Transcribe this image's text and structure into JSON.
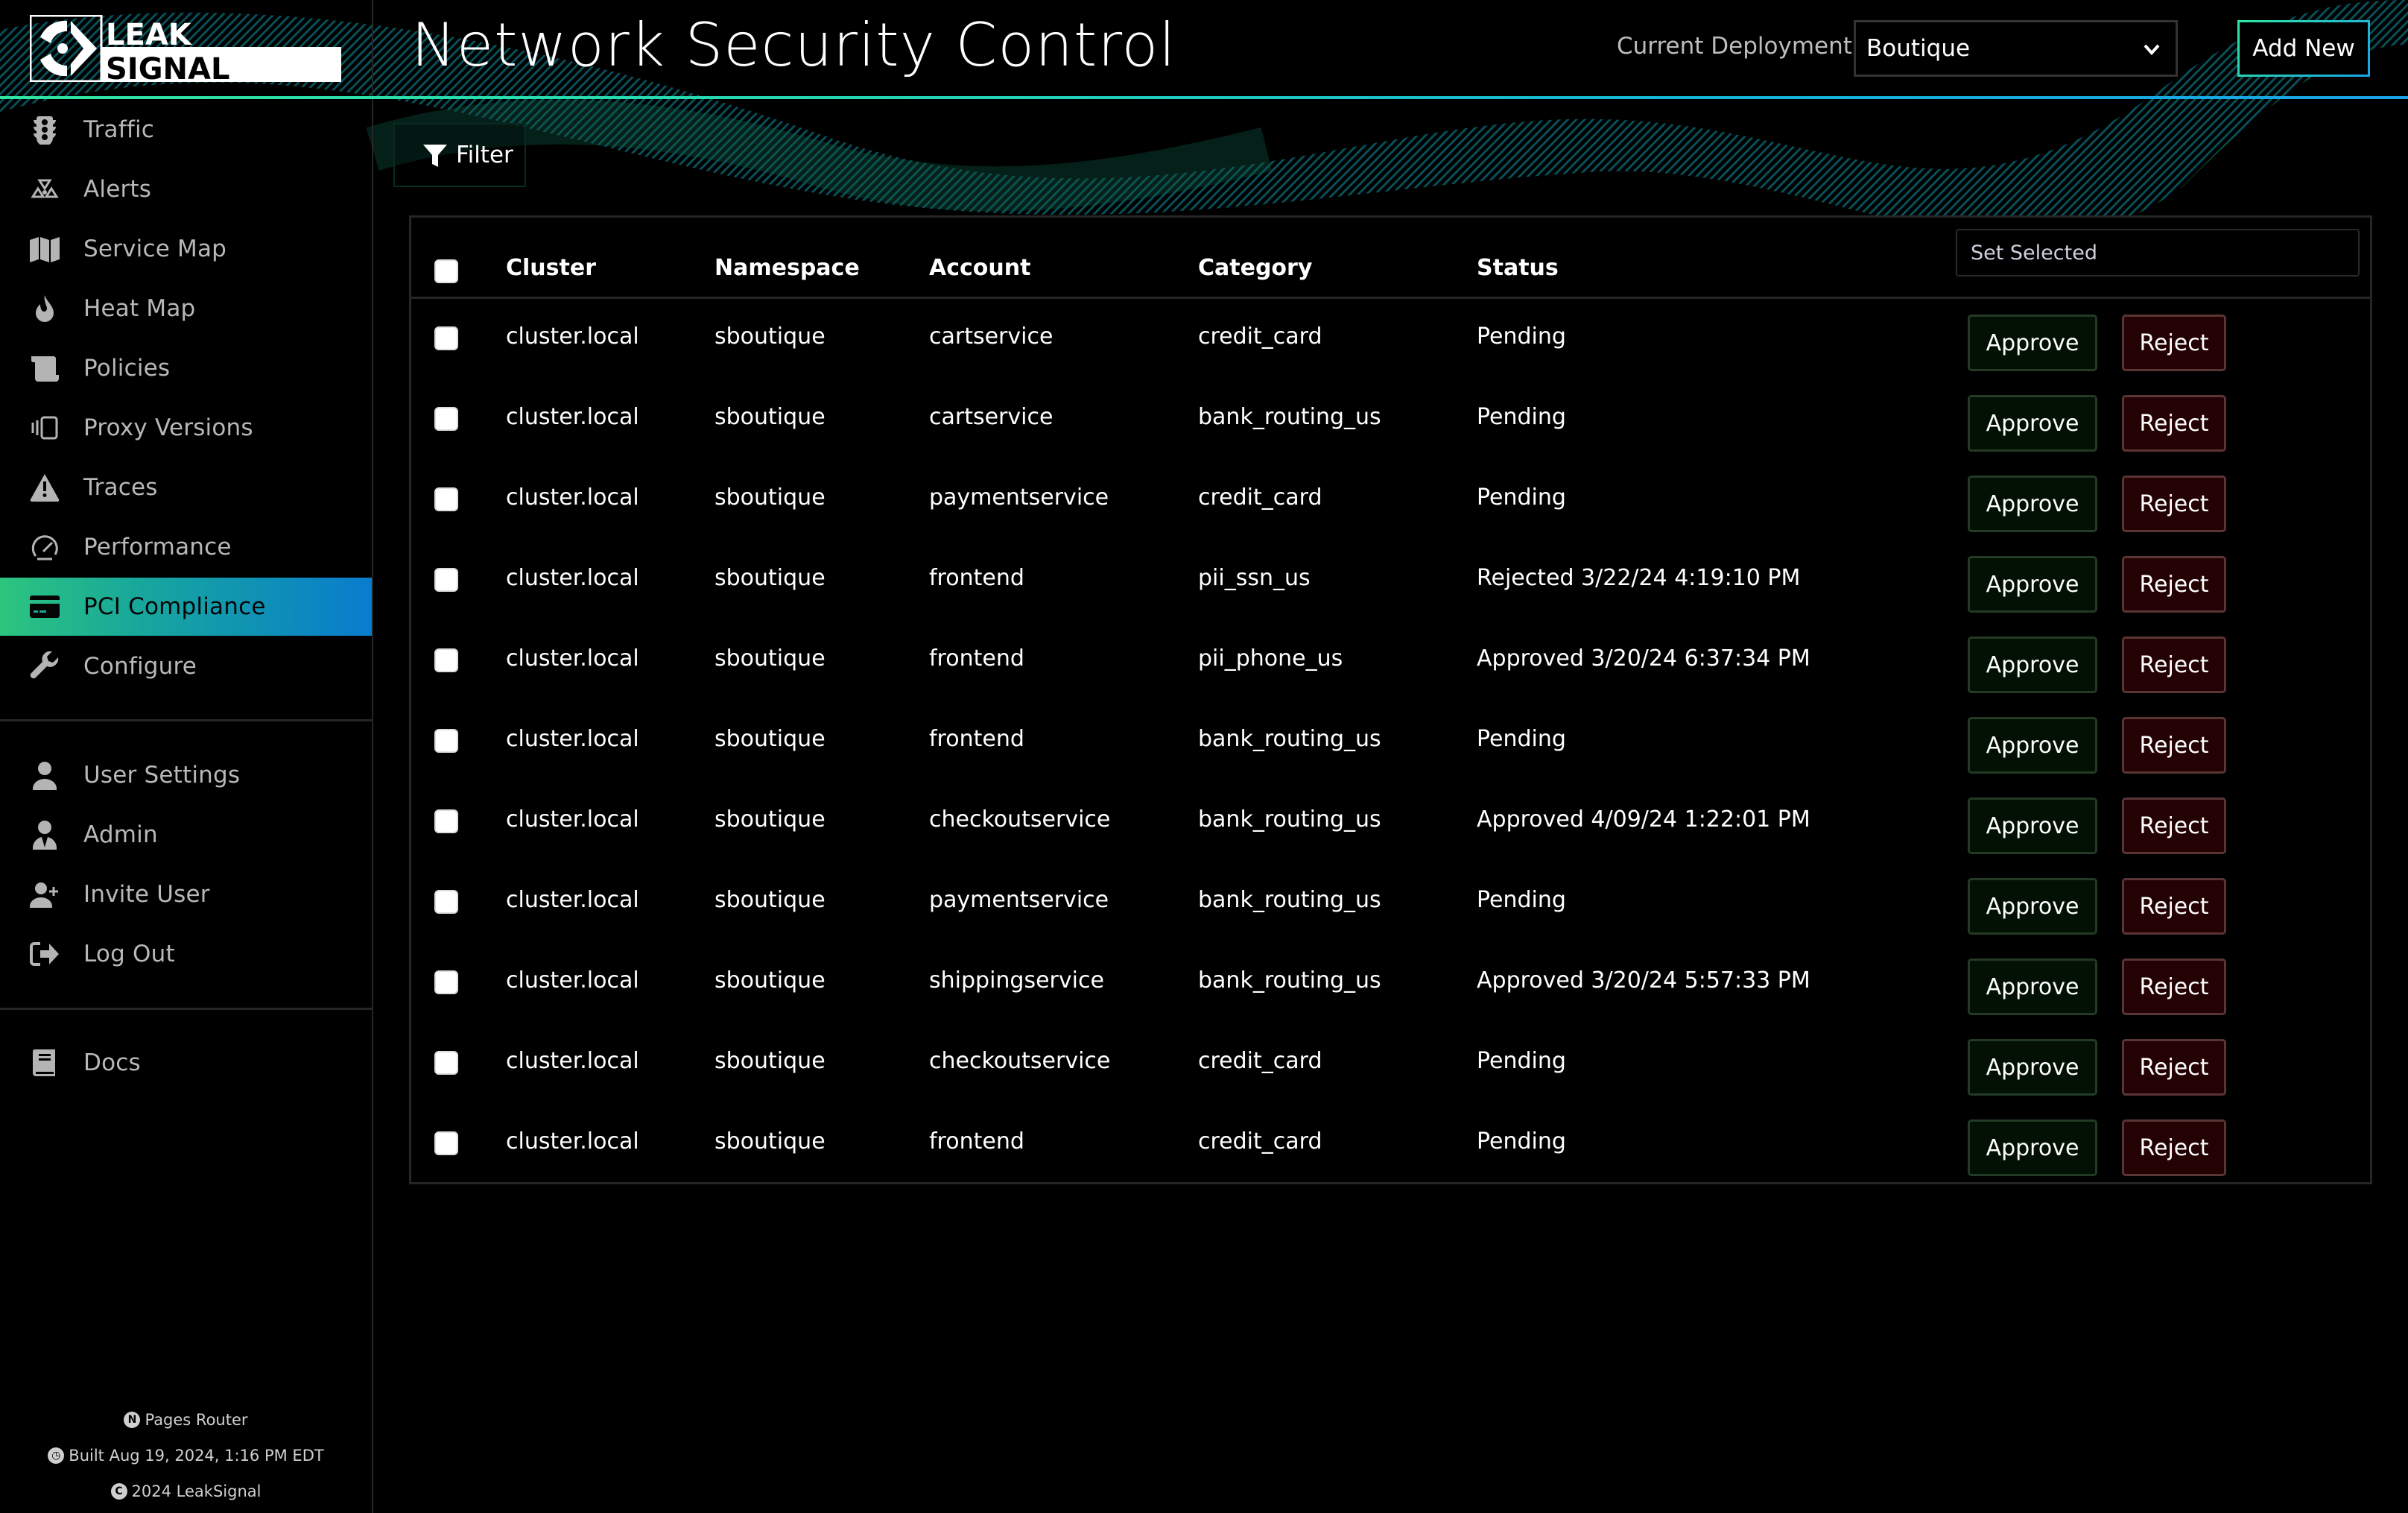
{
  "app": {
    "logo_text_line1": "LEAK",
    "logo_text_line2": "SIGNAL",
    "page_title": "Network Security Control"
  },
  "header": {
    "deployment_label": "Current Deployment:",
    "deployment_value": "Boutique",
    "add_new_label": "Add New"
  },
  "colors": {
    "accent_green": "#2ee6a0",
    "accent_blue": "#1aa3e8",
    "approve_bg": "#021103",
    "reject_bg": "#240102"
  },
  "sidebar": {
    "primary": [
      {
        "label": "Traffic",
        "icon": "traffic-light-icon"
      },
      {
        "label": "Alerts",
        "icon": "radiation-icon"
      },
      {
        "label": "Service Map",
        "icon": "map-icon"
      },
      {
        "label": "Heat Map",
        "icon": "fire-icon"
      },
      {
        "label": "Policies",
        "icon": "scroll-icon"
      },
      {
        "label": "Proxy Versions",
        "icon": "tablets-icon"
      },
      {
        "label": "Traces",
        "icon": "warning-triangle-icon"
      },
      {
        "label": "Performance",
        "icon": "gauge-icon"
      },
      {
        "label": "PCI Compliance",
        "icon": "credit-card-icon",
        "active": true
      },
      {
        "label": "Configure",
        "icon": "wrench-icon"
      }
    ],
    "secondary": [
      {
        "label": "User Settings",
        "icon": "user-icon"
      },
      {
        "label": "Admin",
        "icon": "user-tie-icon"
      },
      {
        "label": "Invite User",
        "icon": "user-plus-icon"
      },
      {
        "label": "Log Out",
        "icon": "sign-out-icon"
      }
    ],
    "tertiary": [
      {
        "label": "Docs",
        "icon": "book-icon"
      }
    ],
    "footer": {
      "router": "Pages Router",
      "built": "Built Aug 19, 2024, 1:16 PM EDT",
      "copyright": "2024 LeakSignal"
    }
  },
  "filter": {
    "label": "Filter"
  },
  "table": {
    "columns": [
      "Cluster",
      "Namespace",
      "Account",
      "Category",
      "Status"
    ],
    "set_selected_placeholder": "Set Selected",
    "approve_label": "Approve",
    "reject_label": "Reject",
    "rows": [
      {
        "cluster": "cluster.local",
        "namespace": "sboutique",
        "account": "cartservice",
        "category": "credit_card",
        "status": "Pending"
      },
      {
        "cluster": "cluster.local",
        "namespace": "sboutique",
        "account": "cartservice",
        "category": "bank_routing_us",
        "status": "Pending"
      },
      {
        "cluster": "cluster.local",
        "namespace": "sboutique",
        "account": "paymentservice",
        "category": "credit_card",
        "status": "Pending"
      },
      {
        "cluster": "cluster.local",
        "namespace": "sboutique",
        "account": "frontend",
        "category": "pii_ssn_us",
        "status": "Rejected 3/22/24 4:19:10 PM"
      },
      {
        "cluster": "cluster.local",
        "namespace": "sboutique",
        "account": "frontend",
        "category": "pii_phone_us",
        "status": "Approved 3/20/24 6:37:34 PM"
      },
      {
        "cluster": "cluster.local",
        "namespace": "sboutique",
        "account": "frontend",
        "category": "bank_routing_us",
        "status": "Pending"
      },
      {
        "cluster": "cluster.local",
        "namespace": "sboutique",
        "account": "checkoutservice",
        "category": "bank_routing_us",
        "status": "Approved 4/09/24 1:22:01 PM"
      },
      {
        "cluster": "cluster.local",
        "namespace": "sboutique",
        "account": "paymentservice",
        "category": "bank_routing_us",
        "status": "Pending"
      },
      {
        "cluster": "cluster.local",
        "namespace": "sboutique",
        "account": "shippingservice",
        "category": "bank_routing_us",
        "status": "Approved 3/20/24 5:57:33 PM"
      },
      {
        "cluster": "cluster.local",
        "namespace": "sboutique",
        "account": "checkoutservice",
        "category": "credit_card",
        "status": "Pending"
      },
      {
        "cluster": "cluster.local",
        "namespace": "sboutique",
        "account": "frontend",
        "category": "credit_card",
        "status": "Pending"
      }
    ]
  }
}
